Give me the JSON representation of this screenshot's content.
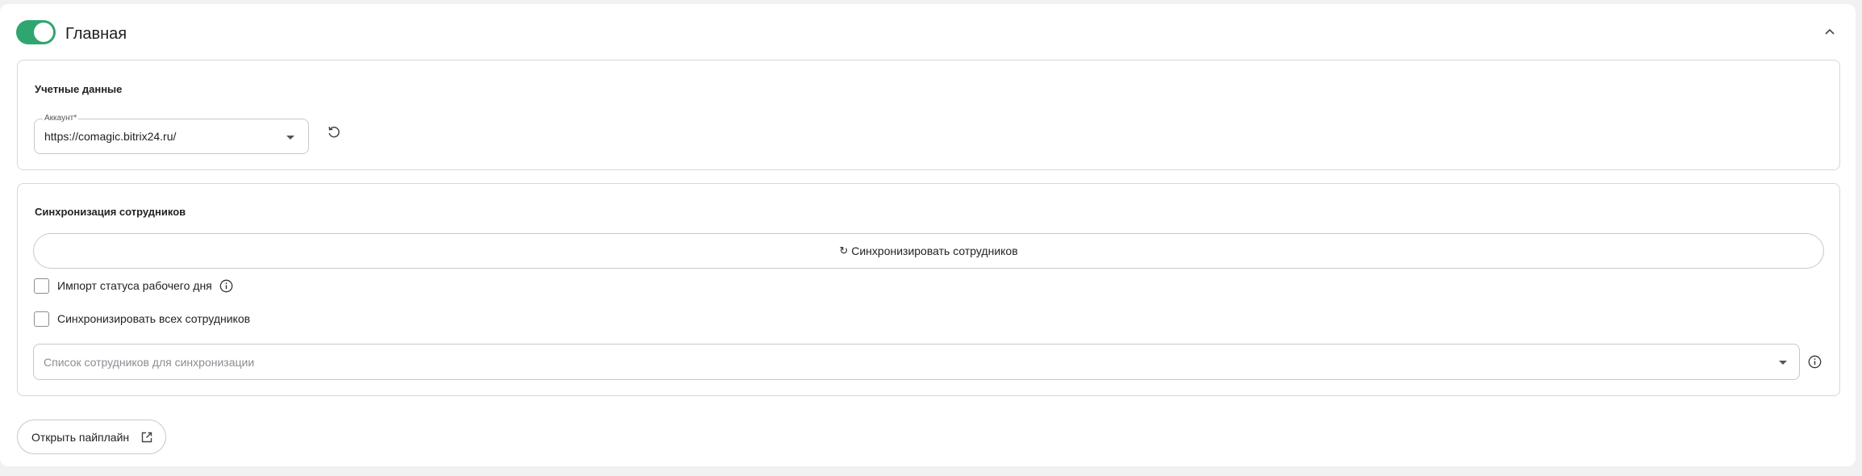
{
  "header": {
    "toggle_on": true,
    "title": "Главная",
    "collapse_icon": "chevron-up-icon"
  },
  "credentials": {
    "title": "Учетные данные",
    "account": {
      "label": "Аккаунт*",
      "value": "https://comagic.bitrix24.ru/"
    },
    "reload_icon": "refresh-icon"
  },
  "sync": {
    "title": "Синхронизация сотрудников",
    "button_glyph": "↻",
    "button_label": "Синхронизировать сотрудников",
    "import_status": {
      "label": "Импорт статуса рабочего дня",
      "checked": false
    },
    "sync_all": {
      "label": "Синхронизировать всех сотрудников",
      "checked": false
    },
    "employee_list": {
      "placeholder": "Список сотрудников для синхронизации"
    }
  },
  "footer": {
    "open_pipeline_label": "Открыть пайплайн",
    "open_pipeline_icon": "external-link-icon"
  },
  "colors": {
    "accent": "#2fa66f",
    "border": "#d5d7dc",
    "background": "#f1f1f2"
  }
}
